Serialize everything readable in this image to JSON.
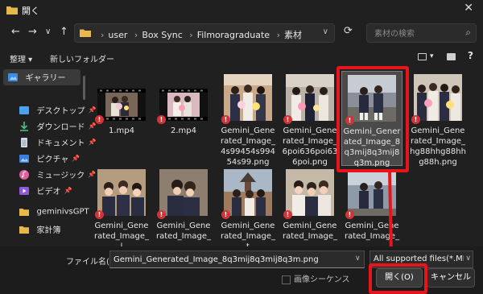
{
  "window": {
    "title": "開く"
  },
  "nav": {
    "back": "←",
    "forward": "→",
    "dropdown": "∨",
    "up": "↑",
    "refresh": "⟳"
  },
  "address": {
    "crumbs": [
      "user",
      "Box Sync",
      "Filmoragraduate",
      "素材"
    ],
    "separator": "›"
  },
  "search": {
    "placeholder": "素材の検索"
  },
  "toolbar": {
    "organize": "整理 ▾",
    "new_folder": "新しいフォルダー"
  },
  "sidebar": {
    "items": [
      {
        "label": "ギャラリー",
        "icon": "gallery-icon",
        "pinned": false
      },
      {
        "label": "デスクトップ",
        "icon": "desktop-icon",
        "pinned": true
      },
      {
        "label": "ダウンロード",
        "icon": "download-icon",
        "pinned": true
      },
      {
        "label": "ドキュメント",
        "icon": "documents-icon",
        "pinned": true
      },
      {
        "label": "ピクチャ",
        "icon": "pictures-icon",
        "pinned": true
      },
      {
        "label": "ミュージック",
        "icon": "music-icon",
        "pinned": true
      },
      {
        "label": "ビデオ",
        "icon": "videos-icon",
        "pinned": true
      },
      {
        "label": "geminivsGPT",
        "icon": "folder-icon",
        "pinned": false
      },
      {
        "label": "家計簿",
        "icon": "folder-icon",
        "pinned": false
      }
    ]
  },
  "files": [
    {
      "name": "1.mp4",
      "kind": "video"
    },
    {
      "name": "2.mp4",
      "kind": "video"
    },
    {
      "name": "Gemini_Generated_Image_4s99454s99454s99.png",
      "kind": "image"
    },
    {
      "name": "Gemini_Generated_Image_6poi636poi636poi.png",
      "kind": "image"
    },
    {
      "name": "Gemini_Generated_Image_8q3mij8q3mij8q3m.png",
      "kind": "image",
      "selected": true
    },
    {
      "name": "Gemini_Generated_Image_hg88hhg88hhg88h.png",
      "kind": "image"
    },
    {
      "name": "Gemini_Generated_Image_l",
      "kind": "image"
    },
    {
      "name": "Gemini_Generated_Image_",
      "kind": "image"
    },
    {
      "name": "Gemini_Generated_Image_t",
      "kind": "image"
    },
    {
      "name": "Gemini_Generated_Image_",
      "kind": "image"
    },
    {
      "name": "Gemini_Generated_Image_",
      "kind": "image"
    }
  ],
  "bottom": {
    "filename_label": "ファイル名(N):",
    "filename_value": "Gemini_Generated_Image_8q3mij8q3mij8q3m.png",
    "filter_value": "All supported files(*.MP4;*",
    "image_sequence": "画像シーケンス",
    "open_button": "開く(O)",
    "cancel_button": "キャンセル"
  },
  "colors": {
    "background": "#202020",
    "highlight": "#e8141b",
    "warning": "#d13438",
    "folder": "#e8b94a"
  }
}
